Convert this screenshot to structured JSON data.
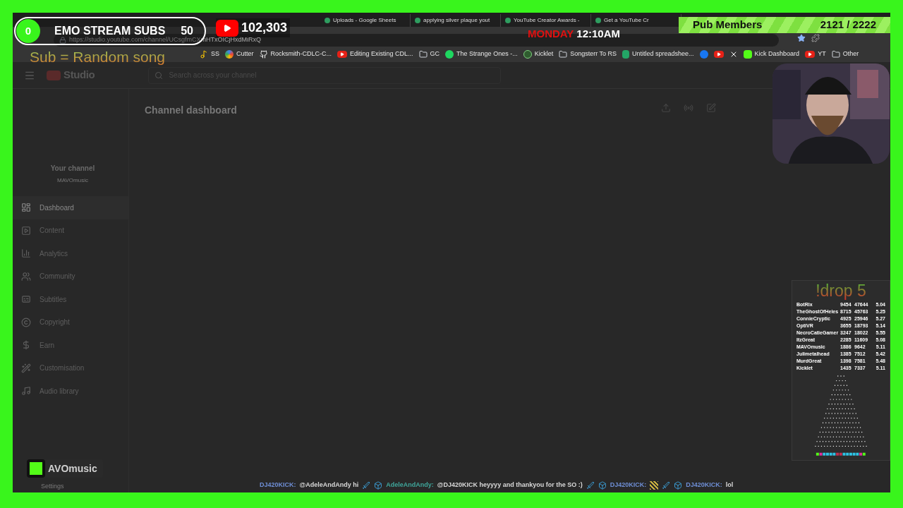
{
  "browser": {
    "tabs": [
      {
        "title": "Uploads - Google Sheets"
      },
      {
        "title": "applying silver plaque yout"
      },
      {
        "title": "YouTube Creator Awards -"
      },
      {
        "title": "Get a YouTube Cr"
      }
    ],
    "url": "https://studio.youtube.com/channel/UCsgfmCXmHTxOICjHxdMiRxQ",
    "bookmarks": [
      {
        "kind": "note",
        "label": "SS"
      },
      {
        "kind": "dots",
        "label": "Cutter"
      },
      {
        "kind": "github",
        "label": "Rocksmith-CDLC-C..."
      },
      {
        "kind": "video",
        "label": "Editing Existing CDL..."
      },
      {
        "kind": "folder",
        "label": "GC"
      },
      {
        "kind": "circle",
        "label": "The Strange Ones -..."
      },
      {
        "kind": "kicklet",
        "label": "Kicklet"
      },
      {
        "kind": "folder",
        "label": "Songsterr To RS"
      },
      {
        "kind": "sheet",
        "label": "Untitled spreadshee..."
      },
      {
        "kind": "facebook"
      },
      {
        "kind": "video"
      },
      {
        "kind": "x"
      },
      {
        "kind": "kick",
        "label": "Kick Dashboard"
      },
      {
        "kind": "video",
        "label": "YT"
      },
      {
        "kind": "folder",
        "label": "Other"
      }
    ]
  },
  "studio": {
    "logo": "Studio",
    "search": {
      "placeholder": "Search across your channel"
    },
    "page_title": "Channel dashboard",
    "channel": {
      "heading": "Your channel",
      "name": "MAVOmusic"
    },
    "nav": [
      {
        "kind": "dashboard",
        "label": "Dashboard",
        "selected": true
      },
      {
        "kind": "content",
        "label": "Content",
        "selected": false
      },
      {
        "kind": "analytics",
        "label": "Analytics",
        "selected": false
      },
      {
        "kind": "community",
        "label": "Community",
        "selected": false
      },
      {
        "kind": "subtitles",
        "label": "Subtitles",
        "selected": false
      },
      {
        "kind": "copyright",
        "label": "Copyright",
        "selected": false
      },
      {
        "kind": "earn",
        "label": "Earn",
        "selected": false
      },
      {
        "kind": "customisation",
        "label": "Customisation",
        "selected": false
      },
      {
        "kind": "audio",
        "label": "Audio library",
        "selected": false
      }
    ],
    "settings": "Settings"
  },
  "overlay": {
    "sub_goal": {
      "count": "0",
      "label": "EMO STREAM SUBS",
      "goal": "50"
    },
    "youtube_subs": "102,303",
    "sub_note": "Sub = Random song",
    "clock": {
      "day": "MONDAY",
      "time": "12:10AM"
    },
    "members": {
      "label": "Pub Members",
      "count": "2121 / 2222"
    },
    "drop": {
      "title": "!drop 5",
      "rows": [
        {
          "name": "BotRix",
          "column_2": "9454",
          "column_3": "47644",
          "column_4": "5.04"
        },
        {
          "name": "TheGhostOfHeles",
          "column_2": "8715",
          "column_3": "45763",
          "column_4": "5.25"
        },
        {
          "name": "ConnieCryptic",
          "column_2": "4925",
          "column_3": "25946",
          "column_4": "5.27"
        },
        {
          "name": "OptiVR",
          "column_2": "3655",
          "column_3": "18793",
          "column_4": "5.14"
        },
        {
          "name": "NecroCatieGamer",
          "column_2": "3247",
          "column_3": "18022",
          "column_4": "5.55"
        },
        {
          "name": "ItzGreat",
          "column_2": "2285",
          "column_3": "11609",
          "column_4": "5.08"
        },
        {
          "name": "MAVOmusic",
          "column_2": "1886",
          "column_3": "9642",
          "column_4": "5.11"
        },
        {
          "name": "Julimetalhead",
          "column_2": "1385",
          "column_3": "7512",
          "column_4": "5.42"
        },
        {
          "name": "MurdGreat",
          "column_2": "1398",
          "column_3": "7581",
          "column_4": "5.48"
        },
        {
          "name": "Kicklet",
          "column_2": "1435",
          "column_3": "7337",
          "column_4": "5.11"
        }
      ]
    },
    "kick_badge": "AVOmusic",
    "chat": [
      {
        "user": "DJ420KICK:",
        "color": "#6f8fd6",
        "text": "@AdeleAndAndy hi"
      },
      {
        "user": "AdeleAndAndy:",
        "color": "#3fa59a",
        "text": "@DJ420KICK heyyyy and thankyou for the SO :)"
      },
      {
        "user": "DJ420KICK:",
        "color": "#6f8fd6"
      },
      {
        "user": "DJ420KICK:",
        "color": "#6f8fd6",
        "text": "lol"
      }
    ]
  }
}
